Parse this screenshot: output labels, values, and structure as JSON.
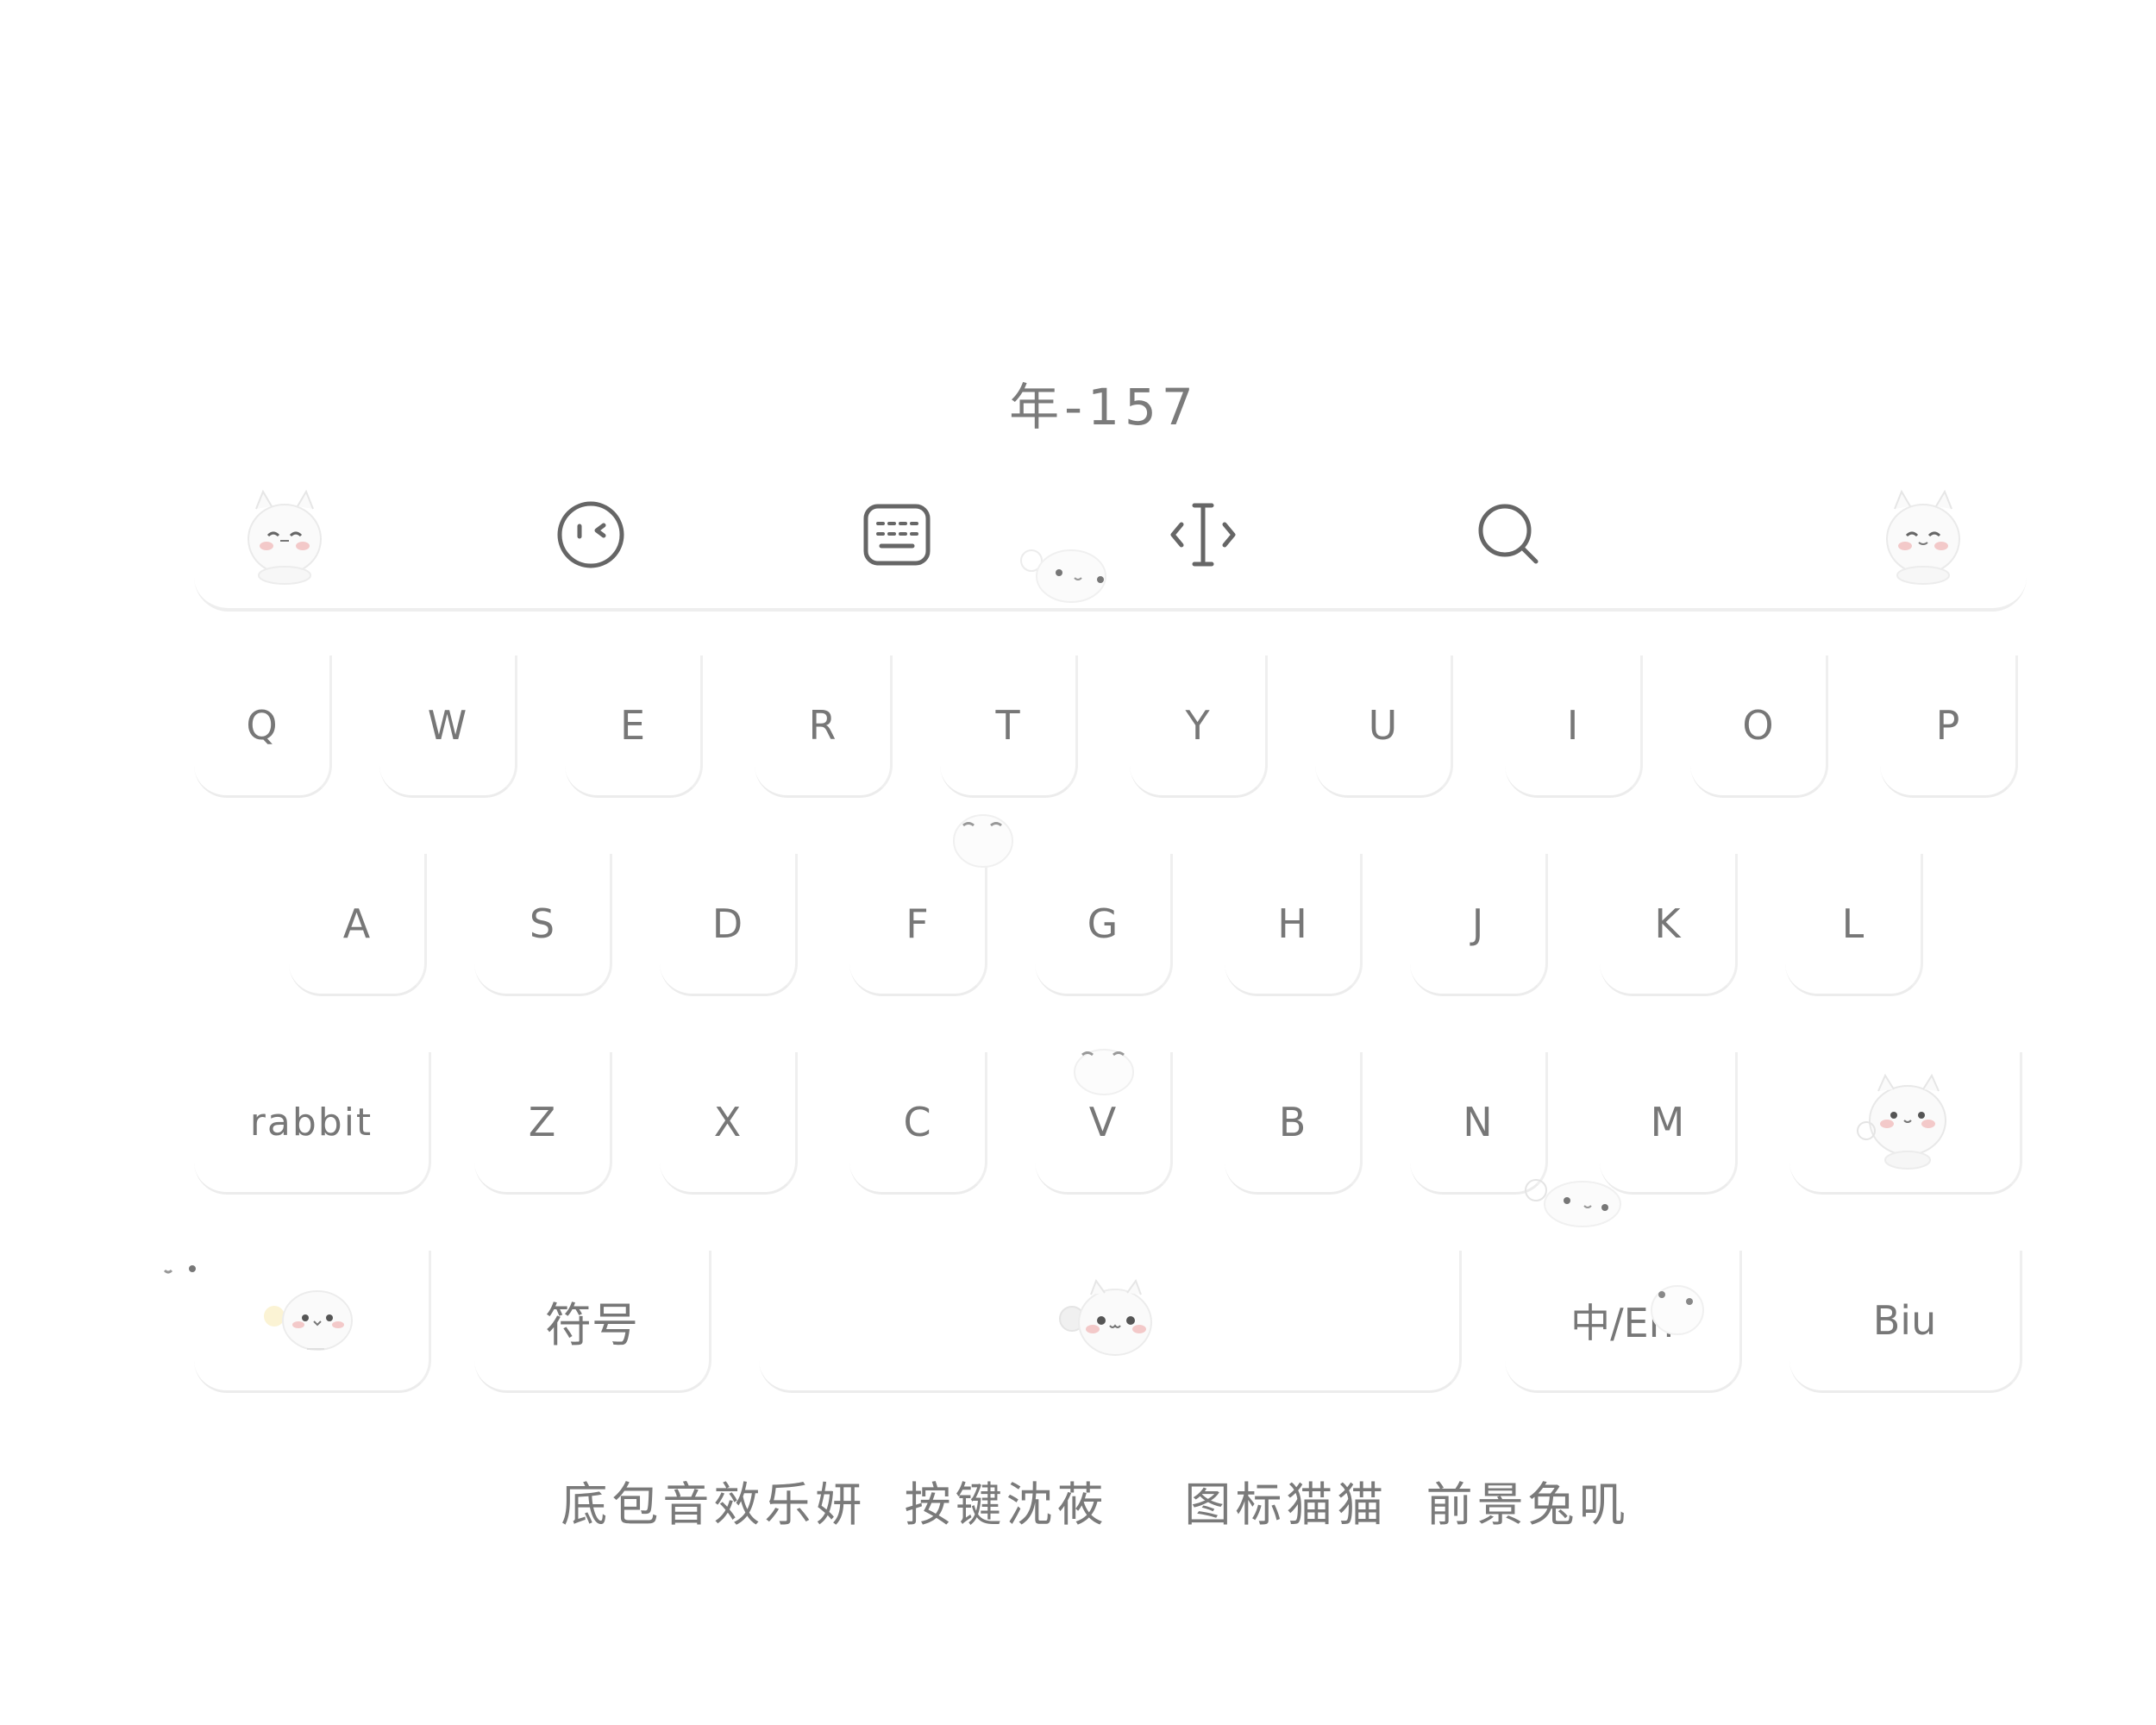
{
  "title": "年-157",
  "toolbar": {
    "items": [
      {
        "icon": "bunny-mascot-icon"
      },
      {
        "icon": "emoji-face-icon"
      },
      {
        "icon": "keyboard-icon"
      },
      {
        "icon": "text-cursor-icon"
      },
      {
        "icon": "search-icon"
      },
      {
        "icon": "bunny-mascot-icon"
      }
    ]
  },
  "keyboard": {
    "row1": [
      "Q",
      "W",
      "E",
      "R",
      "T",
      "Y",
      "U",
      "I",
      "O",
      "P"
    ],
    "row2": [
      "A",
      "S",
      "D",
      "F",
      "G",
      "H",
      "J",
      "K",
      "L"
    ],
    "row3": {
      "left": "rabbit",
      "letters": [
        "Z",
        "X",
        "C",
        "V",
        "B",
        "N",
        "M"
      ]
    },
    "row4": {
      "symbols": "符号",
      "lang": "中/En",
      "right": "Biu"
    }
  },
  "footer": "底包音效乐妍  按键沈莜    图标猫猫  前景兔叽",
  "colors": {
    "text": "#777777",
    "key_shadow": "#ececec",
    "background": "#ffffff",
    "blush": "#f3c9c9"
  }
}
